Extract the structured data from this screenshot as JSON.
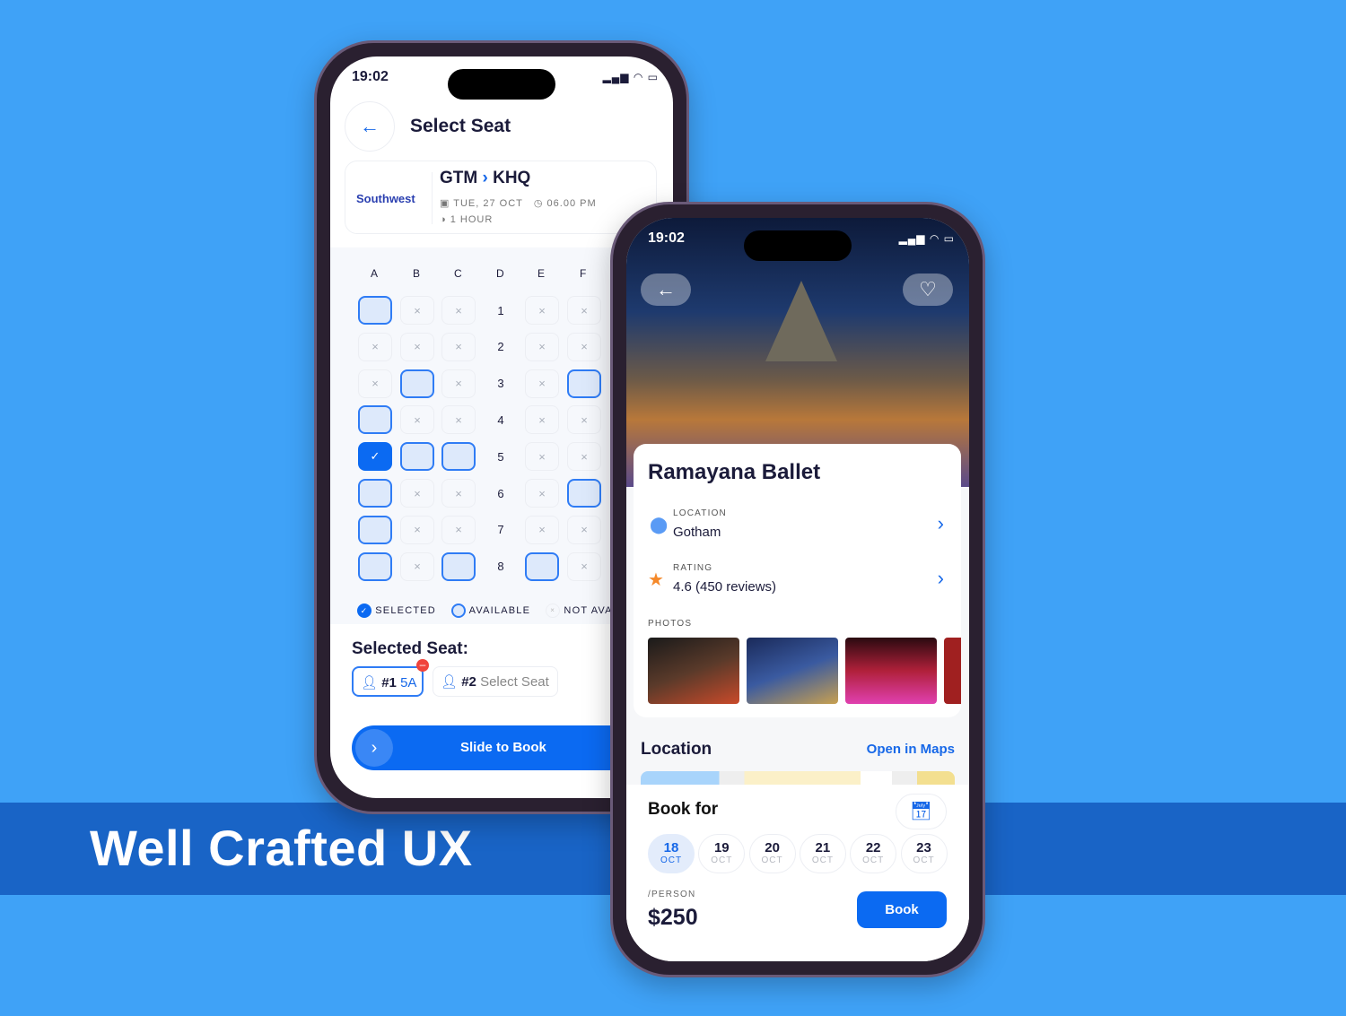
{
  "banner": {
    "title": "Well Crafted UX"
  },
  "colors": {
    "background": "#3fa2f7",
    "band": "#1964c6",
    "accent": "#0b6af2"
  },
  "seat_screen": {
    "status": {
      "time": "19:02"
    },
    "title": "Select Seat",
    "flight": {
      "airline": "Southwest",
      "from": "GTM",
      "to": "KHQ",
      "date": "TUE, 27 OCT",
      "time": "06.00 PM",
      "duration": "1 HOUR"
    },
    "columns": [
      "A",
      "B",
      "C",
      "D",
      "E",
      "F"
    ],
    "rows": [
      {
        "num": "1",
        "seats": [
          "a",
          "x",
          "x",
          "x",
          "x"
        ]
      },
      {
        "num": "2",
        "seats": [
          "x",
          "x",
          "x",
          "x",
          "x"
        ]
      },
      {
        "num": "3",
        "seats": [
          "x",
          "a",
          "x",
          "x",
          "a"
        ]
      },
      {
        "num": "4",
        "seats": [
          "a",
          "x",
          "x",
          "x",
          "x"
        ]
      },
      {
        "num": "5",
        "seats": [
          "s",
          "a",
          "a",
          "x",
          "x"
        ]
      },
      {
        "num": "6",
        "seats": [
          "a",
          "x",
          "x",
          "x",
          "a"
        ]
      },
      {
        "num": "7",
        "seats": [
          "a",
          "x",
          "x",
          "x",
          "x"
        ]
      },
      {
        "num": "8",
        "seats": [
          "a",
          "x",
          "a",
          "a",
          "x"
        ]
      }
    ],
    "legend": {
      "selected": "SELECTED",
      "available": "AVAILABLE",
      "not_available": "NOT AVAI"
    },
    "selected_title": "Selected Seat:",
    "passengers": [
      {
        "num": "#1",
        "seat": "5A"
      },
      {
        "num": "#2",
        "seat": "Select Seat"
      }
    ],
    "slide_label": "Slide to Book"
  },
  "event_screen": {
    "status": {
      "time": "19:02"
    },
    "title": "Ramayana Ballet",
    "location": {
      "label": "LOCATION",
      "value": "Gotham"
    },
    "rating": {
      "label": "RATING",
      "value": "4.6 (450 reviews)"
    },
    "photos_label": "PHOTOS",
    "location_section": {
      "title": "Location",
      "link": "Open in Maps"
    },
    "book_for": "Book for",
    "dates": [
      {
        "day": "18",
        "month": "OCT",
        "selected": true
      },
      {
        "day": "19",
        "month": "OCT"
      },
      {
        "day": "20",
        "month": "OCT"
      },
      {
        "day": "21",
        "month": "OCT"
      },
      {
        "day": "22",
        "month": "OCT"
      },
      {
        "day": "23",
        "month": "OCT"
      }
    ],
    "price_label": "/PERSON",
    "price": "$250",
    "book_button": "Book"
  }
}
